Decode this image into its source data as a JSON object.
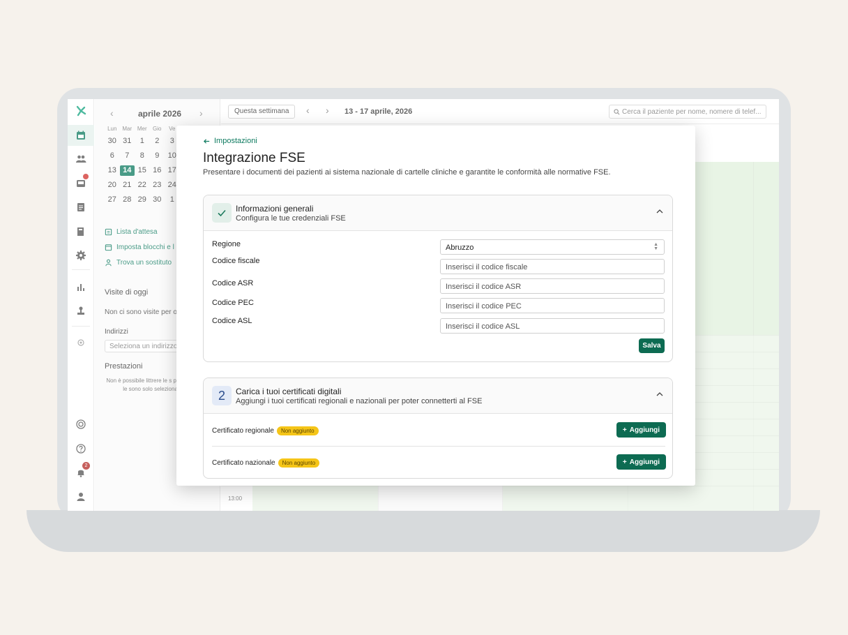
{
  "calendar": {
    "month": "aprile 2026",
    "dow": [
      "Lun",
      "Mar",
      "Mer",
      "Gio",
      "Ve"
    ],
    "rows": [
      [
        "30",
        "31",
        "1",
        "2",
        "3"
      ],
      [
        "6",
        "7",
        "8",
        "9",
        "10"
      ],
      [
        "13",
        "14",
        "15",
        "16",
        "17"
      ],
      [
        "20",
        "21",
        "22",
        "23",
        "24"
      ],
      [
        "27",
        "28",
        "29",
        "30",
        "1"
      ]
    ],
    "today": "14"
  },
  "left": {
    "links": [
      "Lista d'attesa",
      "Imposta blocchi e l",
      "Trova un sostituto"
    ],
    "visits_title": "Visite di oggi",
    "visits_empty": "Non ci sono visite per o",
    "addresses_title": "Indirizzi",
    "address_placeholder": "Seleziona un indirizzo",
    "services_title": "Prestazioni",
    "services_note": "Non è possibile littrere le s poiche non le sono solo selezionato."
  },
  "rail": {
    "notification_count": "2"
  },
  "topbar": {
    "this_week": "Questa settimana",
    "range": "13 - 17 aprile, 2026",
    "search_placeholder": "Cerca il paziente per nome, nomere di telef..."
  },
  "grid": {
    "hour_label": "13:00"
  },
  "modal": {
    "back_label": "Impostazioni",
    "title": "Integrazione FSE",
    "subtitle": "Presentare i documenti dei pazienti ai sistema nazionale di cartelle cliniche e garantite le conformità alle normative FSE.",
    "general": {
      "title": "Informazioni generali",
      "subtitle": "Configura le tue credenziali FSE",
      "fields": [
        {
          "label": "Regione",
          "value": "Abruzzo",
          "placeholder": ""
        },
        {
          "label": "Codice fiscale",
          "value": "",
          "placeholder": "Inserisci il codice fiscale"
        },
        {
          "label": "Codice ASR",
          "value": "",
          "placeholder": "Inserisci il codice ASR"
        },
        {
          "label": "Codice PEC",
          "value": "",
          "placeholder": "Inserisci il codice PEC"
        },
        {
          "label": "Codice ASL",
          "value": "",
          "placeholder": "Inserisci il codice ASL"
        }
      ],
      "save_label": "Salva"
    },
    "certs": {
      "step": "2",
      "title": "Carica i tuoi certificati digitali",
      "subtitle": "Aggiungi i tuoi certificati regionali e nazionali per poter connetterti al FSE",
      "rows": [
        {
          "label": "Certificato regionale",
          "status": "Non aggiunto",
          "action": "Aggiungi"
        },
        {
          "label": "Certificato nazionale",
          "status": "Non aggiunto",
          "action": "Aggiungi"
        }
      ]
    }
  },
  "colors": {
    "accent": "#0d6b52",
    "pill": "#f5c518",
    "background": "#f6f2ec"
  }
}
